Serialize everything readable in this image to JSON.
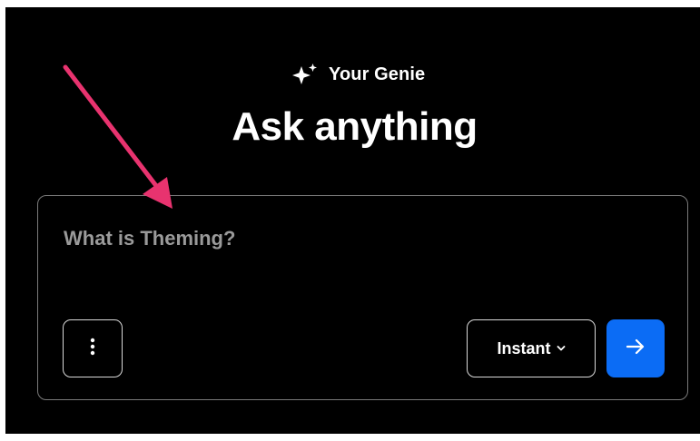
{
  "header": {
    "brand_label": "Your Genie",
    "brand_icon": "sparkles-icon",
    "headline": "Ask anything"
  },
  "prompt": {
    "placeholder": "What is Theming?",
    "value": ""
  },
  "toolbar": {
    "more_icon": "vertical-ellipsis-icon",
    "mode_label": "Instant",
    "mode_icon": "chevron-down-icon",
    "send_icon": "arrow-right-icon"
  },
  "colors": {
    "background": "#000000",
    "accent": "#0b6cf5",
    "annotation": "#e8336f",
    "border": "#7a7a7a"
  }
}
